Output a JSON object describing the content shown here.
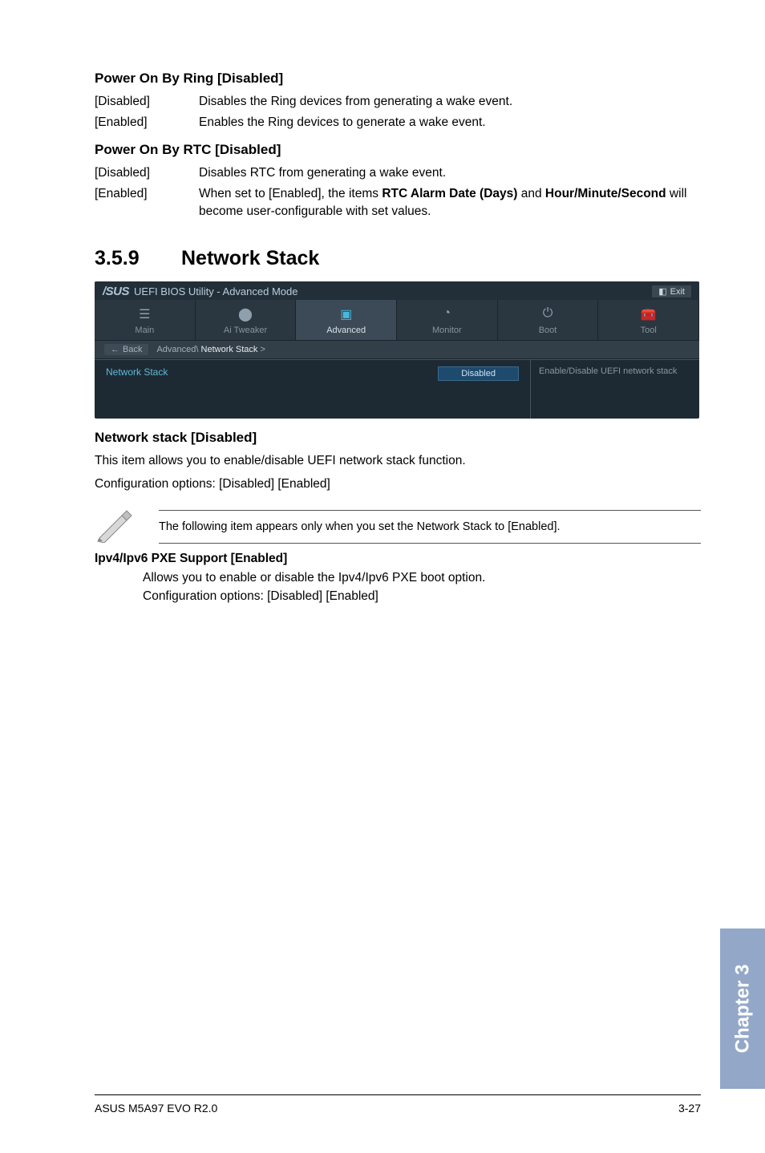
{
  "ring": {
    "heading": "Power On By Ring [Disabled]",
    "opt1_term": "[Disabled]",
    "opt1_desc": "Disables the Ring devices from generating a wake event.",
    "opt2_term": "[Enabled]",
    "opt2_desc": "Enables the Ring devices to generate a wake event."
  },
  "rtc": {
    "heading": "Power On By RTC [Disabled]",
    "opt1_term": "[Disabled]",
    "opt1_desc": "Disables RTC from generating a wake event.",
    "opt2_term": "[Enabled]",
    "opt2_desc_pre": "When set to [Enabled], the items ",
    "opt2_desc_bold1": "RTC Alarm Date (Days)",
    "opt2_desc_mid": " and ",
    "opt2_desc_bold2": "Hour/Minute/Second",
    "opt2_desc_post": " will become user-configurable with set values."
  },
  "section": {
    "num": "3.5.9",
    "title": "Network Stack"
  },
  "bios": {
    "brand": "/SUS",
    "toptitle": "UEFI BIOS Utility - Advanced Mode",
    "exit": "Exit",
    "tabs": {
      "main": "Main",
      "ai": "Ai Tweaker",
      "advanced": "Advanced",
      "monitor": "Monitor",
      "boot": "Boot",
      "tool": "Tool"
    },
    "crumb": {
      "back": "Back",
      "path_grey": "Advanced\\ ",
      "path_white": "Network Stack",
      "path_end": "  >"
    },
    "row_label": "Network Stack",
    "row_value": "Disabled",
    "help": "Enable/Disable UEFI network stack"
  },
  "netstack": {
    "heading": "Network stack [Disabled]",
    "p1": "This item allows you to enable/disable UEFI network stack function.",
    "p2": "Configuration options: [Disabled] [Enabled]"
  },
  "note": "The following item appears only when you set the Network Stack to [Enabled].",
  "pxe": {
    "heading": "Ipv4/Ipv6 PXE Support [Enabled]",
    "l1": "Allows you to enable or disable the Ipv4/Ipv6 PXE boot option.",
    "l2": "Configuration options: [Disabled] [Enabled]"
  },
  "sidetab": "Chapter 3",
  "footer": {
    "left": "ASUS M5A97 EVO R2.0",
    "right": "3-27"
  }
}
